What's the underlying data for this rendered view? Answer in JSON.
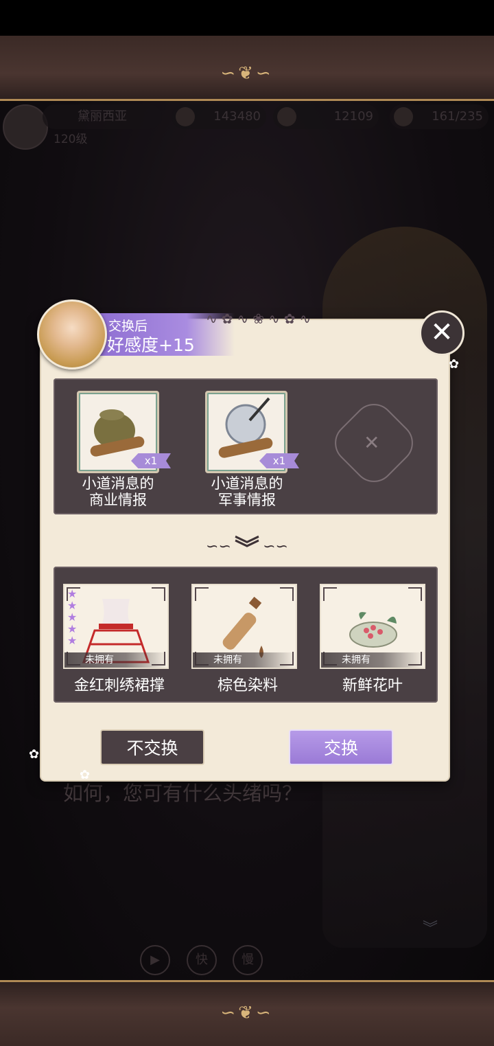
{
  "hud": {
    "player_name": "黛丽西亚",
    "level": "120级",
    "gold": "143480",
    "gems": "12109",
    "stamina": "161/235"
  },
  "dialog": {
    "text": "如何，您可有什么头绪吗？"
  },
  "controls": {
    "auto_icon": "play-icon",
    "fast": "快",
    "slow": "慢"
  },
  "modal": {
    "affection_label": "交换后",
    "affection_value": "好感度+15",
    "close_icon": "close-icon",
    "give_items": [
      {
        "name_line1": "小道消息的",
        "name_line2": "商业情报",
        "qty": "x1",
        "icon": "sack-scroll-icon"
      },
      {
        "name_line1": "小道消息的",
        "name_line2": "军事情报",
        "qty": "x1",
        "icon": "shield-sword-scroll-icon"
      }
    ],
    "empty_slot_icon": "empty-slot-icon",
    "receive_items": [
      {
        "name": "金红刺绣裙撑",
        "status": "未拥有",
        "stars": "★★★★★",
        "icon": "petticoat-icon"
      },
      {
        "name": "棕色染料",
        "status": "未拥有",
        "icon": "dye-vial-icon"
      },
      {
        "name": "新鲜花叶",
        "status": "未拥有",
        "icon": "flower-bowl-icon"
      }
    ],
    "cancel_button": "不交换",
    "confirm_button": "交换"
  },
  "colors": {
    "accent_purple": "#a78bd8",
    "panel_dark": "#4a4044",
    "parchment": "#f3ead9"
  }
}
